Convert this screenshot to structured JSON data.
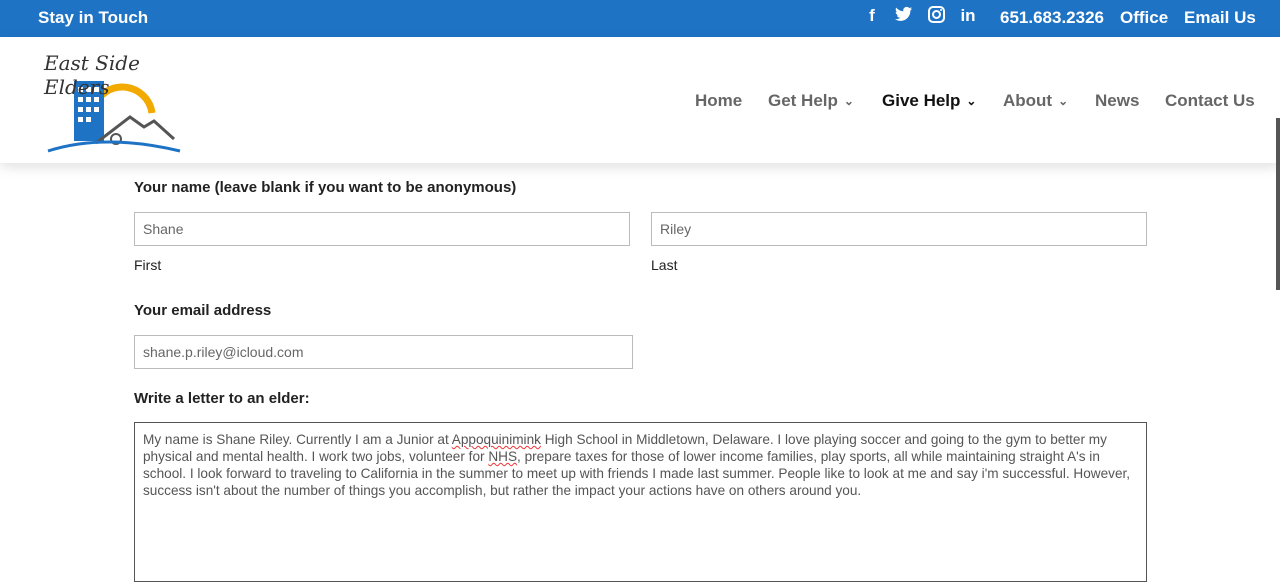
{
  "topbar": {
    "left_label": "Stay in Touch",
    "social_icons": [
      "facebook-icon",
      "twitter-icon",
      "instagram-icon",
      "linkedin-icon"
    ],
    "phone": "651.683.2326",
    "office_label": "Office",
    "email_label": "Email Us"
  },
  "logo": {
    "text": "East Side Elders"
  },
  "nav": {
    "items": [
      {
        "label": "Home",
        "has_dropdown": false
      },
      {
        "label": "Get Help",
        "has_dropdown": true
      },
      {
        "label": "Give Help",
        "has_dropdown": true,
        "active": true
      },
      {
        "label": "About",
        "has_dropdown": true
      },
      {
        "label": "News",
        "has_dropdown": false
      },
      {
        "label": "Contact Us",
        "has_dropdown": false
      }
    ]
  },
  "form": {
    "name_label": "Your name (leave blank if you want to be anonymous)",
    "first_value": "Shane",
    "last_value": "Riley",
    "first_sub": "First",
    "last_sub": "Last",
    "email_label": "Your email address",
    "email_value": "shane.p.riley@icloud.com",
    "letter_label": "Write a letter to an elder:",
    "letter_parts": [
      "My name is Shane Riley. Currently I am a Junior at ",
      "Appoquinimink",
      " High School in Middletown, Delaware. I love playing soccer and going to the gym to better my physical and mental health. I work two jobs, volunteer for ",
      "NHS",
      ", prepare taxes for those of lower income families, play sports, all while maintaining straight A's in school. I look forward to traveling to California in the summer to meet up with friends I made last summer. People like to look at me and say i'm successful. However, success isn't about the number of things you accomplish, but rather the impact your actions have on others around you."
    ]
  },
  "colors": {
    "topbar": "#1f73c5",
    "logo_sun": "#f2a900",
    "logo_blue": "#1f73c5"
  }
}
